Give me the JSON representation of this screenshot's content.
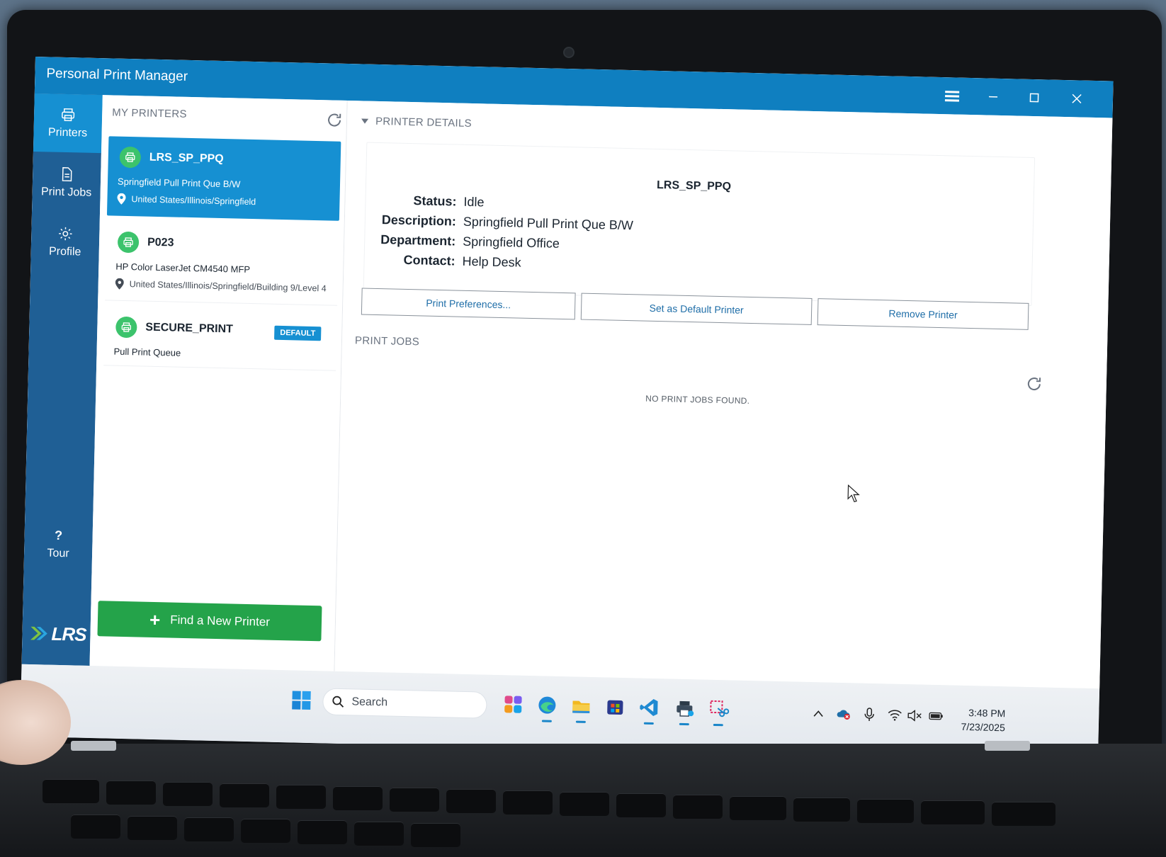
{
  "window": {
    "title": "Personal Print Manager"
  },
  "sidebar": {
    "items": [
      {
        "label": "Printers",
        "icon": "printer-icon",
        "active": true
      },
      {
        "label": "Print Jobs",
        "icon": "document-icon",
        "active": false
      },
      {
        "label": "Profile",
        "icon": "gear-icon",
        "active": false
      }
    ],
    "tour": {
      "symbol": "?",
      "label": "Tour"
    },
    "logo": "LRS"
  },
  "my_printers": {
    "heading": "MY PRINTERS",
    "printers": [
      {
        "name": "LRS_SP_PPQ",
        "description": "Springfield Pull Print Que B/W",
        "location": "United States/Illinois/Springfield",
        "selected": true
      },
      {
        "name": "P023",
        "description": "HP Color LaserJet CM4540 MFP",
        "location": "United States/Illinois/Springfield/Building 9/Level 4",
        "selected": false
      },
      {
        "name": "SECURE_PRINT",
        "description": "Pull Print Queue",
        "badge": "DEFAULT",
        "selected": false
      }
    ],
    "find_button": "Find a New Printer"
  },
  "printer_details": {
    "heading": "PRINTER DETAILS",
    "name": "LRS_SP_PPQ",
    "fields": [
      {
        "label": "Status:",
        "value": "Idle"
      },
      {
        "label": "Description:",
        "value": "Springfield Pull Print Que B/W"
      },
      {
        "label": "Department:",
        "value": "Springfield Office"
      },
      {
        "label": "Contact:",
        "value": "Help Desk"
      }
    ],
    "buttons": {
      "preferences": "Print Preferences...",
      "set_default": "Set as Default Printer",
      "remove": "Remove Printer"
    }
  },
  "print_jobs": {
    "heading": "PRINT JOBS",
    "empty_message": "NO PRINT JOBS FOUND."
  },
  "taskbar": {
    "search_placeholder": "Search",
    "pinned_apps": [
      "copilot-icon",
      "edge-icon",
      "file-explorer-icon",
      "store-icon",
      "vscode-icon",
      "print-manager-icon",
      "snipping-tool-icon"
    ],
    "time": "3:48 PM",
    "date": "7/23/2025"
  },
  "colors": {
    "titlebar": "#0f7fc0",
    "sidebar": "#1f5f95",
    "selected": "#1690d2",
    "accent_green": "#24a34a",
    "printer_icon_green": "#3cc36c"
  }
}
